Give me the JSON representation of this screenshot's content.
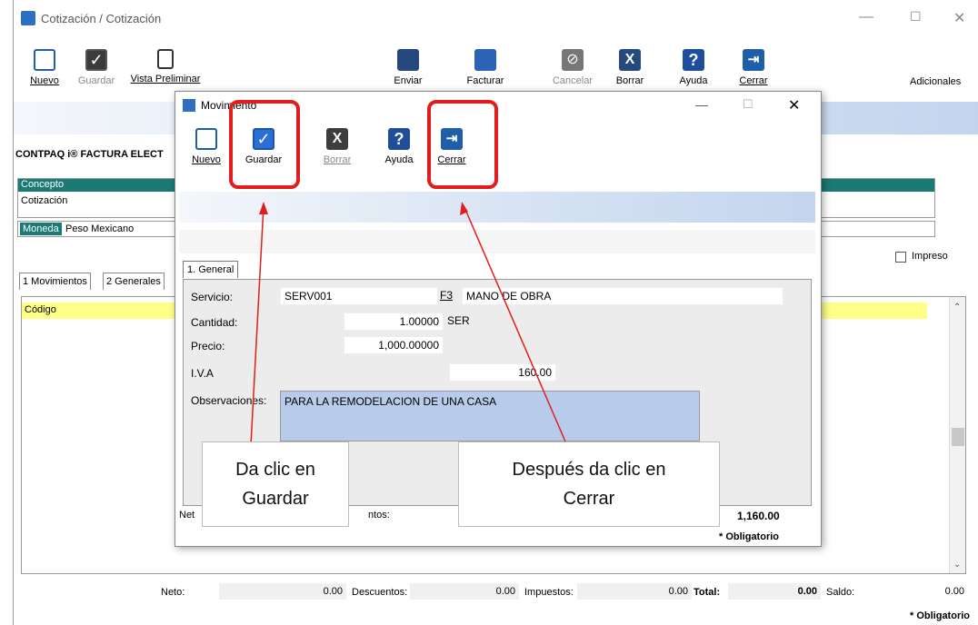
{
  "main": {
    "title": "Cotización / Cotización",
    "toolbar": {
      "nuevo": "Nuevo",
      "guardar": "Guardar",
      "vista": "Vista Preliminar",
      "enviar": "Enviar",
      "facturar": "Facturar",
      "cancelar": "Cancelar",
      "borrar": "Borrar",
      "ayuda": "Ayuda",
      "cerrar": "Cerrar",
      "adicionales": "Adicionales"
    },
    "company": "CONTPAQ i® FACTURA ELECT",
    "concepto_label": "Concepto",
    "concepto_value": "Cotización",
    "moneda_label": "Moneda",
    "moneda_value": "Peso Mexicano",
    "impreso": "Impreso",
    "tabs": [
      "1 Movimientos",
      "2 Generales"
    ],
    "codigo_header": "Código",
    "footer": {
      "neto_label": "Neto:",
      "neto_value": "0.00",
      "descuentos_label": "Descuentos:",
      "descuentos_value": "0.00",
      "impuestos_label": "Impuestos:",
      "impuestos_value": "0.00",
      "total_label": "Total:",
      "total_value": "0.00",
      "saldo_label": "Saldo:",
      "saldo_value": "0.00",
      "obligatorio": "* Obligatorio"
    }
  },
  "dialog": {
    "title": "Movimiento",
    "toolbar": {
      "nuevo": "Nuevo",
      "guardar": "Guardar",
      "borrar": "Borrar",
      "ayuda": "Ayuda",
      "cerrar": "Cerrar"
    },
    "tab": "1. General",
    "servicio_label": "Servicio:",
    "servicio_value": "SERV001",
    "f3": "F3",
    "servicio_desc": "MANO DE OBRA",
    "cantidad_label": "Cantidad:",
    "cantidad_value": "1.00000",
    "unidad": "SER",
    "precio_label": "Precio:",
    "precio_value": "1,000.00000",
    "iva_label": "I.V.A",
    "iva_value": "160.00",
    "obs_label": "Observaciones:",
    "obs_value": "PARA LA REMODELACION DE UNA CASA",
    "neto_partial": "Net",
    "descuentos_partial": "ntos:",
    "total_value": "1,160.00",
    "obligatorio": "* Obligatorio"
  },
  "callouts": {
    "left_line1": "Da clic en",
    "left_line2": "Guardar",
    "right_line1": "Después da clic en",
    "right_line2": "Cerrar"
  },
  "colors": {
    "teal": "#1a7a74",
    "yellow": "#ffff88",
    "highlight_red": "#e01e1e",
    "obs_bg": "#b9cbea"
  }
}
